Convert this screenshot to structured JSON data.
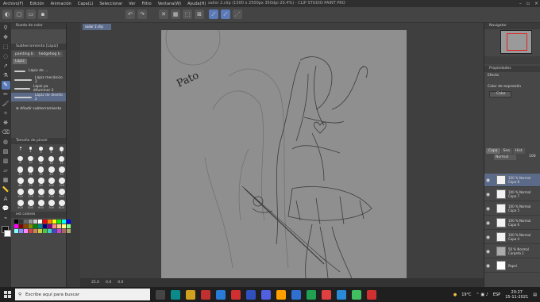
{
  "window": {
    "title": "sailor 2.clip (1500 x 2500px 350dpi 20.4%) - CLIP STUDIO PAINT PRO",
    "menus": [
      "Archivo(F)",
      "Edición",
      "Animación",
      "Capa(L)",
      "Seleccionar",
      "Ver",
      "Filtro",
      "Ventana(W)",
      "Ayuda(H)"
    ]
  },
  "left_panel": {
    "color_wheel_title": "Rueda de color",
    "sub_tool_title": "Subherramienta [Lápiz]",
    "tabs": [
      "painting b",
      "hedgehog b"
    ],
    "active_tab": "Lápiz",
    "brushes": [
      "Lápiz de ...",
      "Lápiz mecánico 2",
      "Lápiz pa difuminar 2",
      "Lápiz de diseño 2"
    ],
    "add_sub_tool": "Añadir subherramienta",
    "brush_size_title": "Tamaño de pincel",
    "brush_sizes": [
      "3",
      "4",
      "5",
      "6",
      "7",
      "8",
      "10",
      "12",
      "15",
      "17",
      "20",
      "25",
      "30",
      "40",
      "50",
      "60",
      "70",
      "80",
      "100",
      "120",
      "150",
      "170",
      "200",
      "250",
      "300",
      "400",
      "500",
      "600",
      "700",
      "800"
    ],
    "color_set_label": "est colores"
  },
  "canvas": {
    "doc_tab": "sailor 2.clip",
    "title_text": "Pato",
    "zoom": "25.0",
    "rotation": "0.0",
    "angle": "0.0"
  },
  "right_panel": {
    "navigator_title": "Navigator",
    "props_title": "Propiedades",
    "effect_label": "Efecto",
    "expression_color_label": "Color de expresión",
    "expression_color_value": "Color",
    "layers_tabs": [
      "Capa",
      "Sea",
      "Hist"
    ],
    "blend_mode": "Normal",
    "opacity": "100",
    "layers": [
      {
        "info": "100 % Normal",
        "name": "Capa 8"
      },
      {
        "info": "100 % Normal",
        "name": "Capa 7"
      },
      {
        "info": "100 % Normal",
        "name": "Capa 5"
      },
      {
        "info": "100 % Normal",
        "name": "Capa 6"
      },
      {
        "info": "100 % Normal",
        "name": "Capa 4"
      },
      {
        "info": "56 % Normal",
        "name": "Carpeta 1"
      },
      {
        "info": "",
        "name": "Papel"
      }
    ]
  },
  "taskbar": {
    "search_placeholder": "Escribe aquí para buscar",
    "weather": "19°C",
    "lang": "ESP",
    "time": "20:27",
    "date": "15-11-2021"
  }
}
